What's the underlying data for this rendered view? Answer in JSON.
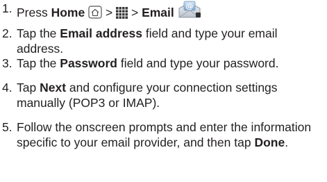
{
  "steps": [
    {
      "number": "1.",
      "press": "Press",
      "home": "Home",
      "sep1": ">",
      "sep2": ">",
      "email": "Email",
      "icons": [
        "home-key-icon",
        "apps-grid-icon",
        "email-app-icon"
      ]
    },
    {
      "number": "2.",
      "pre": "Tap the",
      "bold": "Email address",
      "post": "field and type your email address."
    },
    {
      "number": "3.",
      "pre": "Tap the",
      "bold": "Password",
      "post": "field and type your password."
    },
    {
      "number": "4.",
      "pre": "Tap",
      "bold": "Next",
      "post": "and configure your connection settings manually (POP3 or IMAP)."
    },
    {
      "number": "5.",
      "pre": "Follow the onscreen prompts and enter the information specific to your email provider, and then tap",
      "bold": "Done",
      "post": "."
    }
  ]
}
